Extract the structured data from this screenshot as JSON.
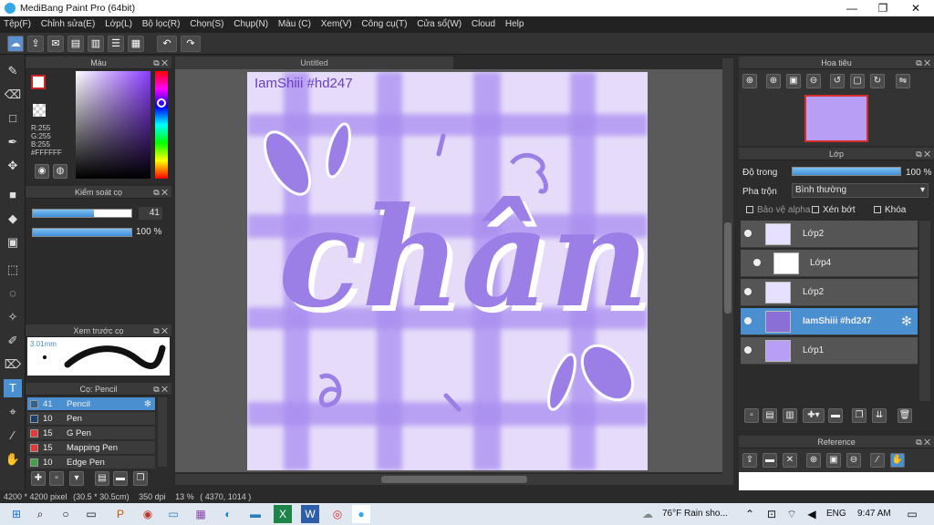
{
  "window": {
    "title": "MediBang Paint Pro (64bit)",
    "minimize": "—",
    "maximize": "❐",
    "close": "✕"
  },
  "menu": [
    "Tệp(F)",
    "Chỉnh sửa(E)",
    "Lớp(L)",
    "Bộ lọc(R)",
    "Chọn(S)",
    "Chụp(N)",
    "Màu (C)",
    "Xem(V)",
    "Công cụ(T)",
    "Cửa sổ(W)",
    "Cloud",
    "Help"
  ],
  "color_panel": {
    "title": "Màu",
    "r": "R:255",
    "g": "G:255",
    "b": "B:255",
    "hex": "#FFFFFF"
  },
  "brush_control": {
    "title": "Kiểm soát cọ",
    "size": "41",
    "opacity": "100 %",
    "size_level": 0.62,
    "opacity_level": 1.0
  },
  "brush_preview": {
    "title": "Xem trước cọ",
    "size_label": "3.01mm"
  },
  "brush_list": {
    "title": "Cọ: Pencil",
    "items": [
      {
        "size": "41",
        "name": "Pencil",
        "selected": true,
        "color": "#3a5f8a"
      },
      {
        "size": "10",
        "name": "Pen",
        "selected": false,
        "color": "#1f3f6a"
      },
      {
        "size": "15",
        "name": "G Pen",
        "selected": false,
        "color": "#e53935"
      },
      {
        "size": "15",
        "name": "Mapping Pen",
        "selected": false,
        "color": "#e53935"
      },
      {
        "size": "10",
        "name": "Edge Pen",
        "selected": false,
        "color": "#43a047"
      }
    ]
  },
  "canvas": {
    "tab_title": "Untitled",
    "label_text": "IamShiii #hd247",
    "art_text": "chân"
  },
  "navigator": {
    "title": "Hoa tiêu"
  },
  "layers_panel": {
    "title": "Lớp",
    "opacity_label": "Độ trong",
    "opacity_value": "100 %",
    "opacity_level": 1.0,
    "blend_label": "Pha trộn",
    "blend_value": "Bình thường",
    "protect_alpha": "Bảo vệ alpha",
    "clipping": "Xén bớt",
    "lock": "Khóa",
    "layers": [
      {
        "name": "Lớp2",
        "selected": false
      },
      {
        "name": "Lớp4",
        "selected": false
      },
      {
        "name": "Lớp2",
        "selected": false
      },
      {
        "name": "IamShiii #hd247",
        "selected": true
      },
      {
        "name": "Lớp1",
        "selected": false
      }
    ]
  },
  "reference": {
    "title": "Reference"
  },
  "status": {
    "size": "4200 * 4200 pixel",
    "dims": "(30.5 * 30.5cm)",
    "dpi": "350 dpi",
    "zoom": "13 %",
    "coords": "( 4370, 1014 )"
  },
  "taskbar": {
    "weather": "76°F  Rain sho...",
    "lang": "ENG",
    "time": "9:47 AM"
  },
  "colors": {
    "accent": "#4a8fd0",
    "canvas_bg": "#e6dcfa",
    "art": "#9b7fe6",
    "grid": "#a98ef0"
  }
}
